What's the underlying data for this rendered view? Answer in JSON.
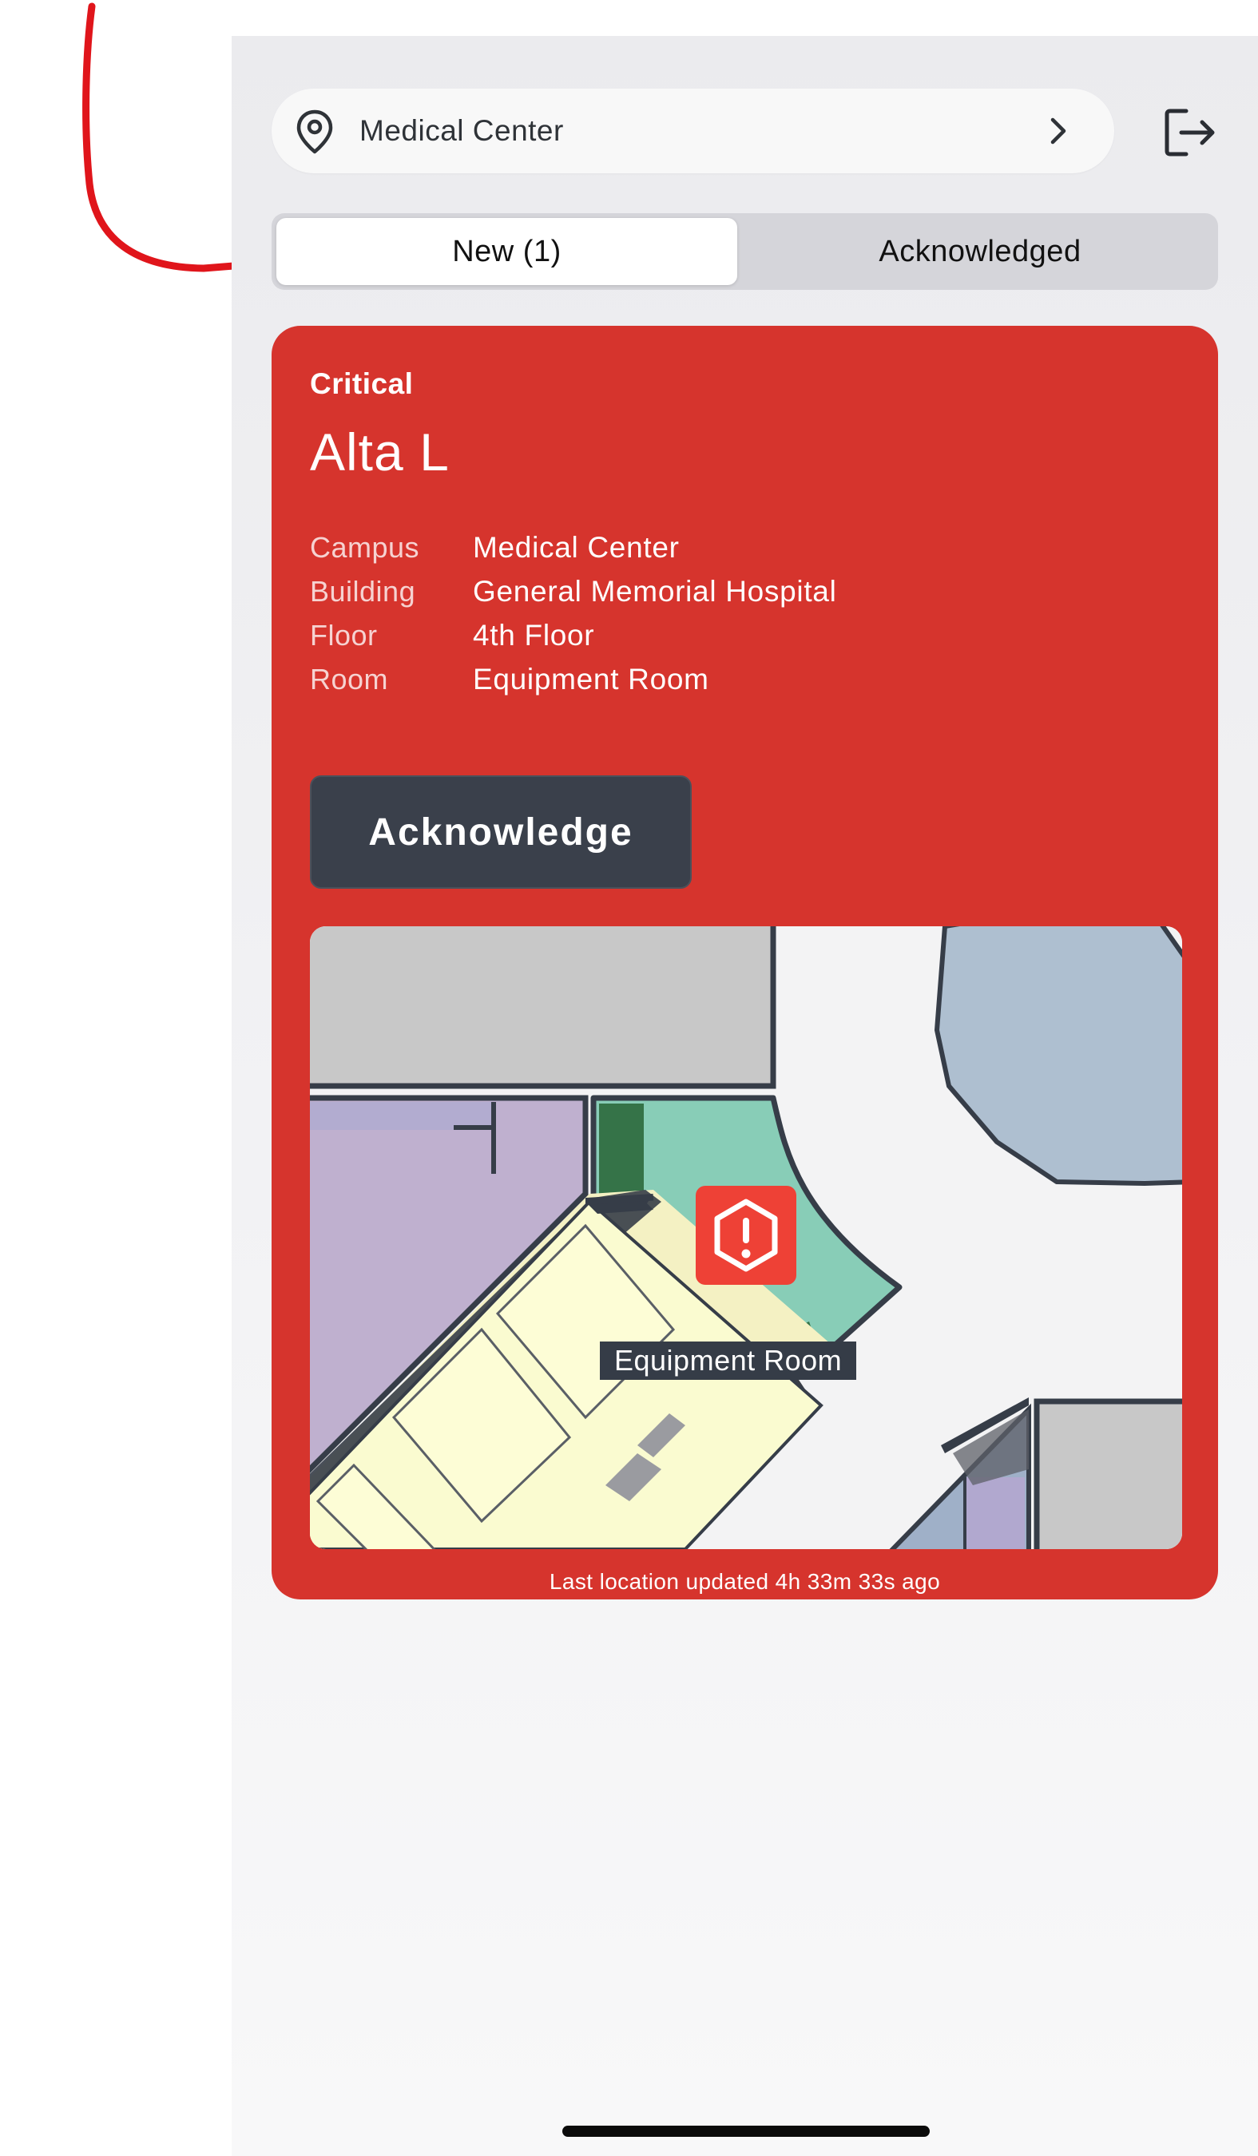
{
  "header": {
    "location_label": "Medical Center",
    "icons": {
      "location": "map-pin-icon",
      "chevron": "chevron-right-icon",
      "logout": "logout-icon"
    }
  },
  "tabs": [
    {
      "label": "New (1)",
      "active": true
    },
    {
      "label": "Acknowledged",
      "active": false
    }
  ],
  "alert": {
    "severity": "Critical",
    "name": "Alta L",
    "details": [
      {
        "key": "Campus",
        "value": "Medical Center"
      },
      {
        "key": "Building",
        "value": "General Memorial Hospital"
      },
      {
        "key": "Floor",
        "value": "4th Floor"
      },
      {
        "key": "Room",
        "value": "Equipment Room"
      }
    ],
    "action_label": "Acknowledge",
    "map_room_label": "Equipment Room",
    "map_marker_icon": "alert-hexagon-icon",
    "last_updated": "Last location updated 4h 33m 33s ago"
  },
  "colors": {
    "alert_bg": "#d6342d",
    "button_bg": "#3a404b",
    "annotation": "#e0151b"
  }
}
